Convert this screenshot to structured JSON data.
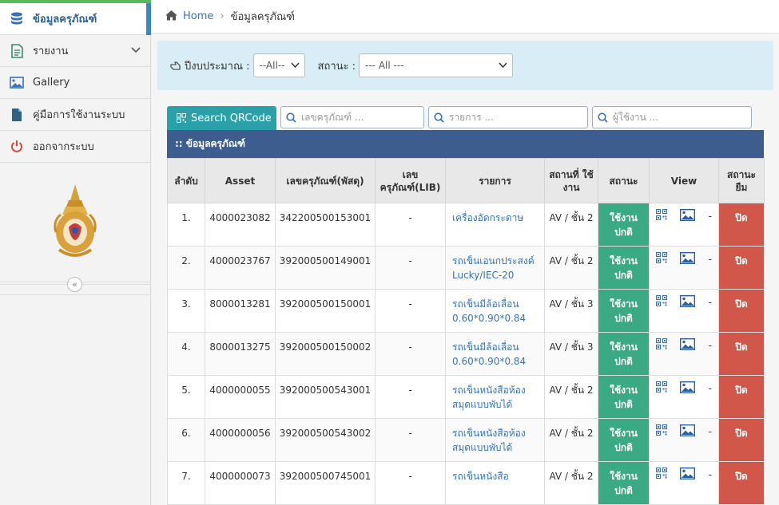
{
  "sidebar": {
    "items": [
      {
        "label": "ข้อมูลครุภัณฑ์",
        "icon": "database-icon"
      },
      {
        "label": "รายงาน",
        "icon": "report-icon"
      },
      {
        "label": "Gallery",
        "icon": "image-icon"
      },
      {
        "label": "คู่มือการใช้งานระบบ",
        "icon": "file-icon"
      },
      {
        "label": "ออกจากระบบ",
        "icon": "power-icon"
      }
    ],
    "logo": "university-emblem",
    "collapse_icon": "double-chevron-left-icon"
  },
  "breadcrumb": {
    "home": "Home",
    "current": "ข้อมูลครุภัณฑ์"
  },
  "filter": {
    "year_label": "ปีงบประมาณ :",
    "year_value": "--All--",
    "status_label": "สถานะ :",
    "status_value": "--- All ---"
  },
  "toolbar": {
    "qr_button": "Search QRCode",
    "search_asset_placeholder": "เลขครุภัณฑ์ ...",
    "search_item_placeholder": "รายการ ...",
    "search_user_placeholder": "ผู้ใช้งาน ..."
  },
  "panel_title": ":: ข้อมูลครุภัณฑ์",
  "table": {
    "headers": [
      "ลำดับ",
      "Asset",
      "เลขครุภัณฑ์(พัสดุ)",
      "เลข ครุภัณฑ์(LIB)",
      "รายการ",
      "สถานที่ ใช้งาน",
      "สถานะ",
      "View",
      "สถานะ ยืม"
    ],
    "rows": [
      {
        "no": "1.",
        "asset": "4000023082",
        "asset_no": "342200500153001",
        "lib": "-",
        "item": "เครื่องอัดกระดาษ",
        "location": "AV / ชั้น 2",
        "status": "ใช้งาน ปกติ",
        "dash": "-",
        "loan": "ปิด"
      },
      {
        "no": "2.",
        "asset": "4000023767",
        "asset_no": "392000500149001",
        "lib": "-",
        "item": "รถเข็นเอนกประสงค์ Lucky/IEC-20",
        "location": "AV / ชั้น 2",
        "status": "ใช้งาน ปกติ",
        "dash": "-",
        "loan": "ปิด"
      },
      {
        "no": "3.",
        "asset": "8000013281",
        "asset_no": "392000500150001",
        "lib": "-",
        "item": "รถเข็นมีล้อเลื่อน 0.60*0.90*0.84",
        "location": "AV / ชั้น 3",
        "status": "ใช้งาน ปกติ",
        "dash": "-",
        "loan": "ปิด"
      },
      {
        "no": "4.",
        "asset": "8000013275",
        "asset_no": "392000500150002",
        "lib": "-",
        "item": "รถเข็นมีล้อเลื่อน 0.60*0.90*0.84",
        "location": "AV / ชั้น 3",
        "status": "ใช้งาน ปกติ",
        "dash": "-",
        "loan": "ปิด"
      },
      {
        "no": "5.",
        "asset": "4000000055",
        "asset_no": "392000500543001",
        "lib": "-",
        "item": "รถเข็นหนังสือห้องสมุดแบบพับได้",
        "location": "AV / ชั้น 2",
        "status": "ใช้งาน ปกติ",
        "dash": "-",
        "loan": "ปิด"
      },
      {
        "no": "6.",
        "asset": "4000000056",
        "asset_no": "392000500543002",
        "lib": "-",
        "item": "รถเข็นหนังสือห้องสมุดแบบพับได้",
        "location": "AV / ชั้น 2",
        "status": "ใช้งาน ปกติ",
        "dash": "-",
        "loan": "ปิด"
      },
      {
        "no": "7.",
        "asset": "4000000073",
        "asset_no": "392000500745001",
        "lib": "-",
        "item": "รถเข็นหนังสือ",
        "location": "AV / ชั้น 2",
        "status": "ใช้งาน ปกติ",
        "dash": "-",
        "loan": "ปิด"
      }
    ]
  },
  "colors": {
    "panel": "#3d5d8e",
    "status_ok": "#3aaa84",
    "loan_closed": "#d0574a",
    "qr_button": "#2aa1a8",
    "filter_bg": "#d9edf7"
  }
}
